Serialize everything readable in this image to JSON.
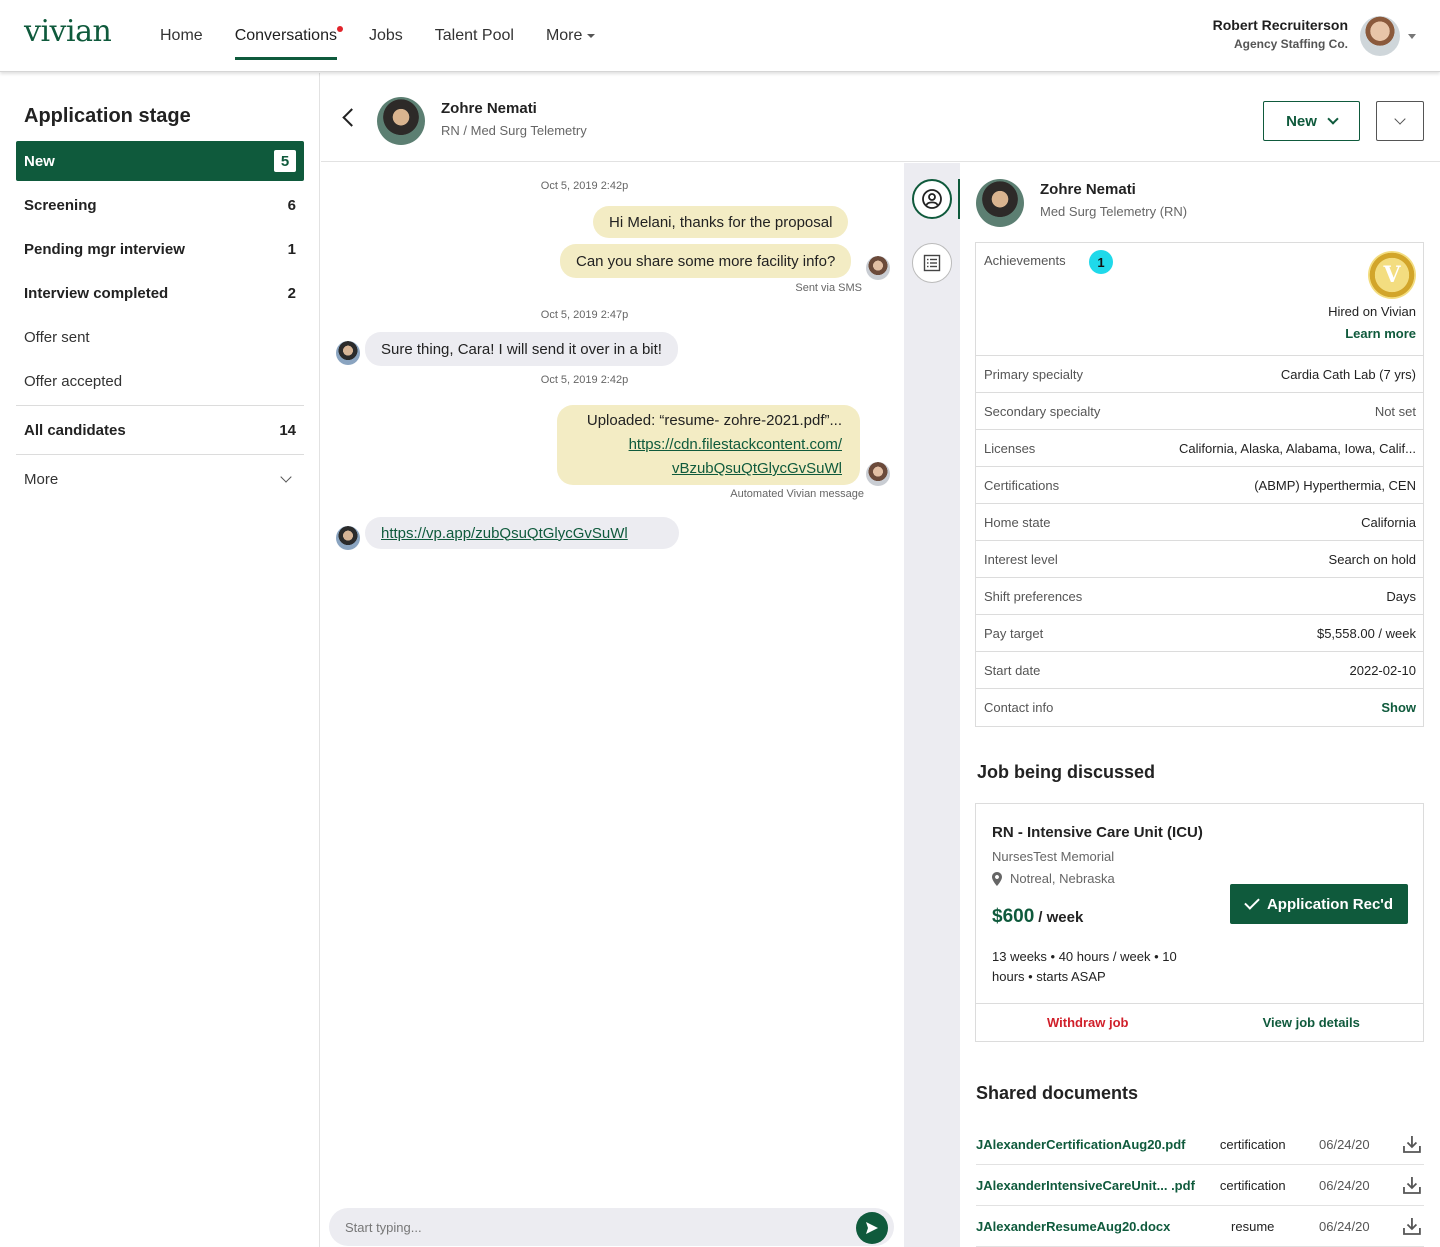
{
  "brand": {
    "logo": "vivian",
    "accent": "#0f5a3c",
    "danger": "#d01f2a",
    "badge": "#1fd9ea"
  },
  "nav": {
    "items": [
      {
        "label": "Home"
      },
      {
        "label": "Conversations",
        "active": true,
        "notification": true
      },
      {
        "label": "Jobs"
      },
      {
        "label": "Talent Pool"
      },
      {
        "label": "More"
      }
    ]
  },
  "user": {
    "name": "Robert Recruiterson",
    "company": "Agency Staffing Co."
  },
  "sidebar": {
    "title": "Application stage",
    "stages": [
      {
        "label": "New",
        "count": "5",
        "selected": true
      },
      {
        "label": "Screening",
        "count": "6"
      },
      {
        "label": "Pending mgr interview",
        "count": "1",
        "bold": true
      },
      {
        "label": "Interview completed",
        "count": "2"
      },
      {
        "label": "Offer sent",
        "count": ""
      },
      {
        "label": "Offer accepted",
        "count": ""
      }
    ],
    "all_candidates": {
      "label": "All candidates",
      "count": "14"
    },
    "more": {
      "label": "More"
    }
  },
  "conversation": {
    "candidate_name": "Zohre Nemati",
    "candidate_role": "RN / Med Surg Telemetry",
    "stage_button": "New",
    "messages": {
      "ts1": "Oct 5, 2019 2:42p",
      "m1": "Hi Melani, thanks for the proposal",
      "m2": "Can you share some more facility info?",
      "m2_meta": "Sent via SMS",
      "ts2": "Oct 5, 2019 2:47p",
      "m3": "Sure thing, Cara! I will send it over in a bit!",
      "ts3": "Oct 5, 2019 2:42p",
      "m4_line1": "Uploaded: “resume- zohre-2021.pdf”...",
      "m4_line2": "https://cdn.filestackcontent.com/",
      "m4_line3": "vBzubQsuQtGlycGvSuWl",
      "m4_meta": "Automated Vivian message",
      "m5": "https://vp.app/zubQsuQtGlycGvSuWl"
    },
    "composer_placeholder": "Start typing..."
  },
  "profile": {
    "name": "Zohre Nemati",
    "role": "Med Surg Telemetry (RN)",
    "achievements": {
      "label": "Achievements",
      "count": "1",
      "medal_letter": "V",
      "title": "Hired on Vivian",
      "link": "Learn more"
    },
    "rows": [
      {
        "key": "Primary specialty",
        "value": "Cardia Cath Lab (7 yrs)"
      },
      {
        "key": "Secondary specialty",
        "value": "Not set"
      },
      {
        "key": "Licenses",
        "value": "California, Alaska, Alabama, Iowa, Calif..."
      },
      {
        "key": "Certifications",
        "value": "(ABMP) Hyperthermia, CEN"
      },
      {
        "key": "Home state",
        "value": "California"
      },
      {
        "key": "Interest level",
        "value": "Search on hold"
      },
      {
        "key": "Shift preferences",
        "value": "Days"
      },
      {
        "key": "Pay target",
        "value": "$5,558.00 / week"
      },
      {
        "key": "Start date",
        "value": "2022-02-10"
      },
      {
        "key": "Contact info",
        "value": "Show"
      }
    ]
  },
  "job": {
    "section_title": "Job being discussed",
    "title": "RN - Intensive Care Unit (ICU)",
    "facility": "NursesTest Memorial",
    "location": "Notreal, Nebraska",
    "pay": "$600",
    "pay_unit": "/ week",
    "details": "13 weeks • 40 hours / week • 10 hours • starts ASAP",
    "status_button": "Application Rec'd",
    "withdraw": "Withdraw job",
    "view": "View job details"
  },
  "documents": {
    "section_title": "Shared documents",
    "items": [
      {
        "name": "JAlexanderCertificationAug20.pdf",
        "type": "certification",
        "date": "06/24/20"
      },
      {
        "name": "JAlexanderIntensiveCareUnit... .pdf",
        "type": "certification",
        "date": "06/24/20"
      },
      {
        "name": "JAlexanderResumeAug20.docx",
        "type": "resume",
        "date": "06/24/20"
      }
    ]
  }
}
